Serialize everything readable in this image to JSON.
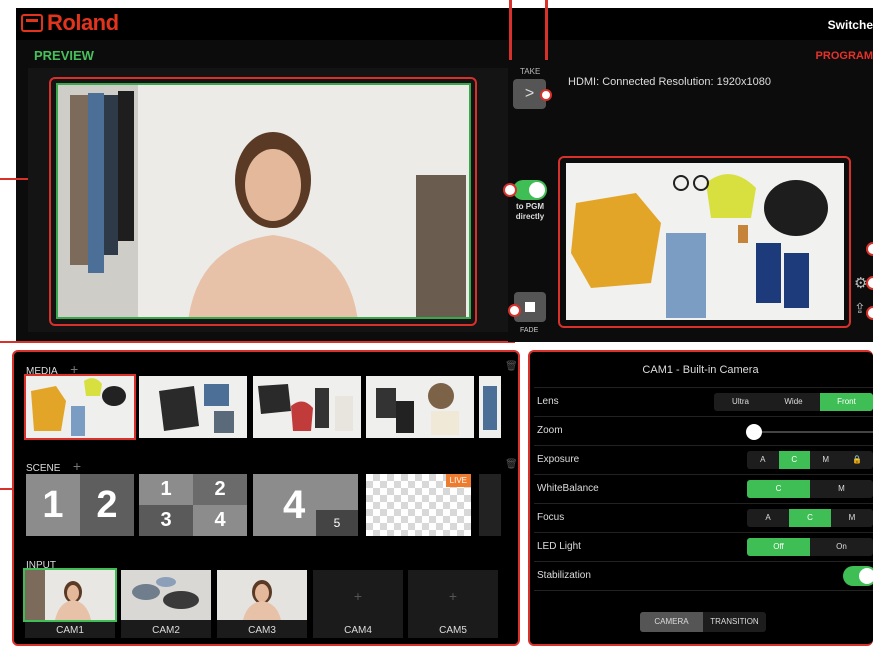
{
  "app": {
    "brand": "Roland",
    "mode_label": "Switche"
  },
  "preview": {
    "label": "PREVIEW"
  },
  "program": {
    "label": "PROGRAM",
    "hdmi_status": "HDMI:  Connected  Resolution: 1920x1080"
  },
  "controls": {
    "take_label": "TAKE",
    "take_glyph": ">",
    "pgm_label": "to PGM\ndirectly",
    "fade_label": "FADE"
  },
  "bottom_left": {
    "media": {
      "label": "MEDIA",
      "add": "+"
    },
    "scene": {
      "label": "SCENE",
      "add": "+",
      "live_badge": "LIVE"
    },
    "input": {
      "label": "INPUT",
      "tiles": [
        "CAM1",
        "CAM2",
        "CAM3",
        "CAM4",
        "CAM5"
      ],
      "add": "+"
    }
  },
  "camera_settings": {
    "title": "CAM1 - Built-in Camera",
    "rows": [
      {
        "label": "Lens",
        "options": [
          "Ultra",
          "Wide",
          "Front"
        ],
        "selected": "Front"
      },
      {
        "label": "Zoom",
        "slider_value": 0
      },
      {
        "label": "Exposure",
        "options": [
          "A",
          "C",
          "M",
          "lock-icon"
        ],
        "selected": "C"
      },
      {
        "label": "WhiteBalance",
        "options": [
          "C",
          "M"
        ],
        "selected": "C"
      },
      {
        "label": "Focus",
        "options": [
          "A",
          "C",
          "M"
        ],
        "selected": "C"
      },
      {
        "label": "LED Light",
        "options": [
          "Off",
          "On"
        ],
        "selected": "Off"
      },
      {
        "label": "Stabilization",
        "toggle": "on"
      }
    ],
    "tabs": [
      "CAMERA",
      "TRANSITION"
    ],
    "active_tab": "CAMERA"
  },
  "scene_tiles": {
    "tile1": [
      "1",
      "2"
    ],
    "tile2": [
      "1",
      "2",
      "3",
      "4"
    ],
    "tile3": [
      "4",
      "5"
    ]
  },
  "colors": {
    "accent_green": "#3fbe55",
    "callout_red": "#d8302a",
    "brand_red": "#e2341d"
  }
}
